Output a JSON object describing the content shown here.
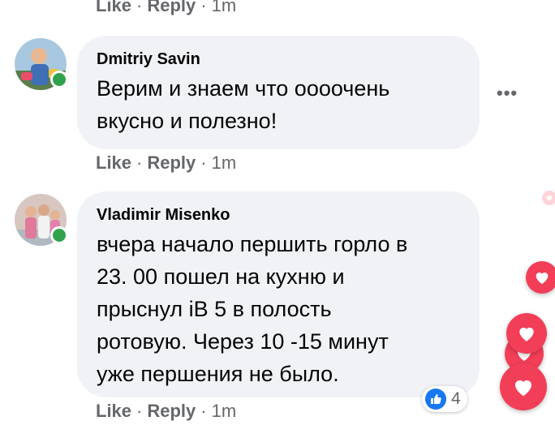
{
  "top_actions": {
    "like": "Like",
    "reply": "Reply",
    "time": "1m"
  },
  "comments": [
    {
      "author": "Dmitriy Savin",
      "text": "Верим и знаем что оооочень\nвкусно и полезно!",
      "actions": {
        "like": "Like",
        "reply": "Reply",
        "time": "1m"
      },
      "avatar_icon": "avatar-photo",
      "online": true
    },
    {
      "author": "Vladimir Misenko",
      "text": "вчера начало першить горло в\n23. 00 пошел на кухню и\nпрыснул iВ 5 в полость\nротовую. Через 10 -15 минут\nуже першения не было.",
      "actions": {
        "like": "Like",
        "reply": "Reply",
        "time": "1m"
      },
      "avatar_icon": "avatar-photo",
      "online": true,
      "reaction": {
        "icon": "like-icon",
        "count": "4"
      }
    }
  ],
  "more_icon": "more-options-icon",
  "floating_reactions_icon": "heart-icon",
  "colors": {
    "bubble": "#f0f2f5",
    "link": "#65676b",
    "online": "#31a24c",
    "like_blue": "#1877f2",
    "heart_red": "#f33e58"
  }
}
